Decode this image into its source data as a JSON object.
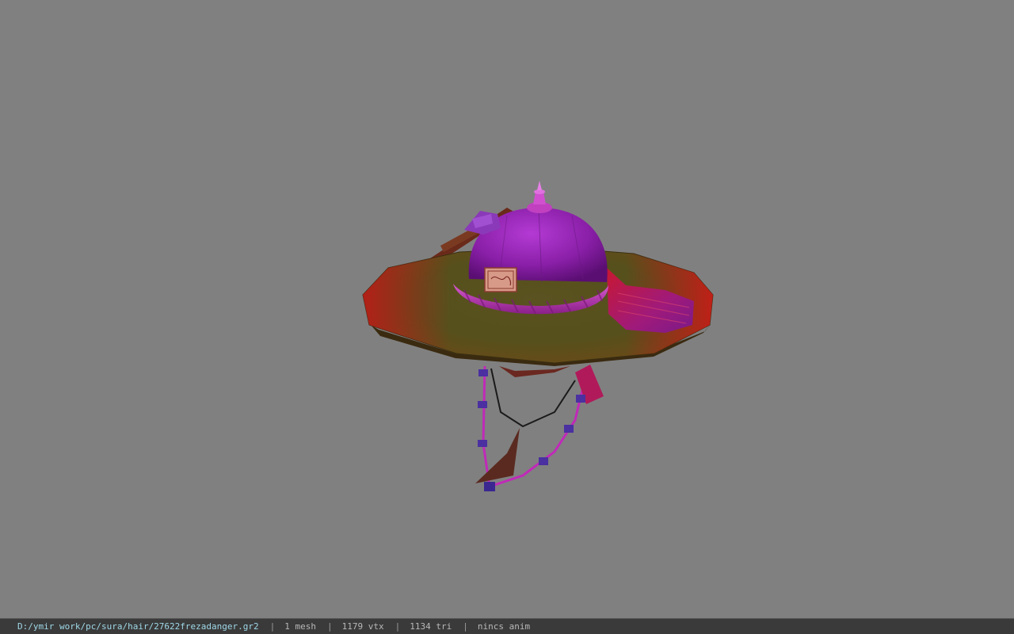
{
  "viewer": {
    "background_color": "#808080",
    "model_icon": "hat-model-icon"
  },
  "statusbar": {
    "file_path": "D:/ymir work/pc/sura/hair/27622frezadanger.gr2",
    "separator": "|",
    "mesh_count": "1 mesh",
    "vertex_count": "1179 vtx",
    "triangle_count": "1134 tri",
    "anim_status": "nincs anim"
  }
}
